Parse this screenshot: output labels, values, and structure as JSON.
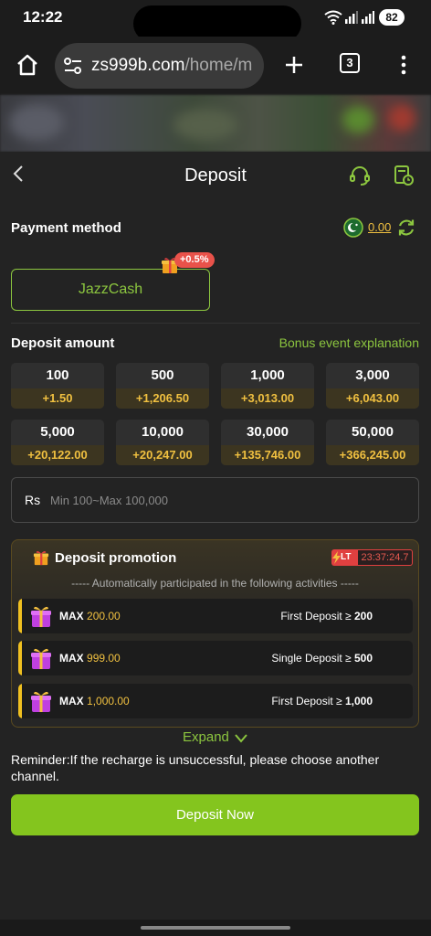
{
  "status_bar": {
    "time": "12:22",
    "battery": "82"
  },
  "browser": {
    "url_domain": "zs999b.com",
    "url_path": "/home/m",
    "tab_count": "3"
  },
  "header": {
    "title": "Deposit"
  },
  "payment": {
    "label": "Payment method",
    "balance": "0.00",
    "method_label": "JazzCash",
    "method_bonus": "+0.5%"
  },
  "deposit_amount": {
    "label": "Deposit amount",
    "bonus_link": "Bonus event explanation",
    "options": [
      {
        "amount": "100",
        "bonus": "+1.50"
      },
      {
        "amount": "500",
        "bonus": "+1,206.50"
      },
      {
        "amount": "1,000",
        "bonus": "+3,013.00"
      },
      {
        "amount": "3,000",
        "bonus": "+6,043.00"
      },
      {
        "amount": "5,000",
        "bonus": "+20,122.00"
      },
      {
        "amount": "10,000",
        "bonus": "+20,247.00"
      },
      {
        "amount": "30,000",
        "bonus": "+135,746.00"
      },
      {
        "amount": "50,000",
        "bonus": "+366,245.00"
      }
    ],
    "currency_prefix": "Rs",
    "input_placeholder": "Min 100~Max 100,000"
  },
  "promotion": {
    "title": "Deposit promotion",
    "timer_tag": "LT",
    "timer": "23:37:24.7",
    "subtitle": "----- Automatically participated in the following activities -----",
    "activities": [
      {
        "max_label": "MAX",
        "max_value": "200.00",
        "condition": "First Deposit ≥",
        "threshold": "200"
      },
      {
        "max_label": "MAX",
        "max_value": "999.00",
        "condition": "Single Deposit ≥",
        "threshold": "500"
      },
      {
        "max_label": "MAX",
        "max_value": "1,000.00",
        "condition": "First Deposit ≥",
        "threshold": "1,000"
      }
    ],
    "expand_label": "Expand"
  },
  "reminder": "Reminder:If the recharge is unsuccessful, please choose another channel.",
  "deposit_button": "Deposit Now",
  "colors": {
    "accent": "#8cc63f",
    "button": "#84c51e",
    "bonus": "#f0c040",
    "alert": "#e04040"
  }
}
